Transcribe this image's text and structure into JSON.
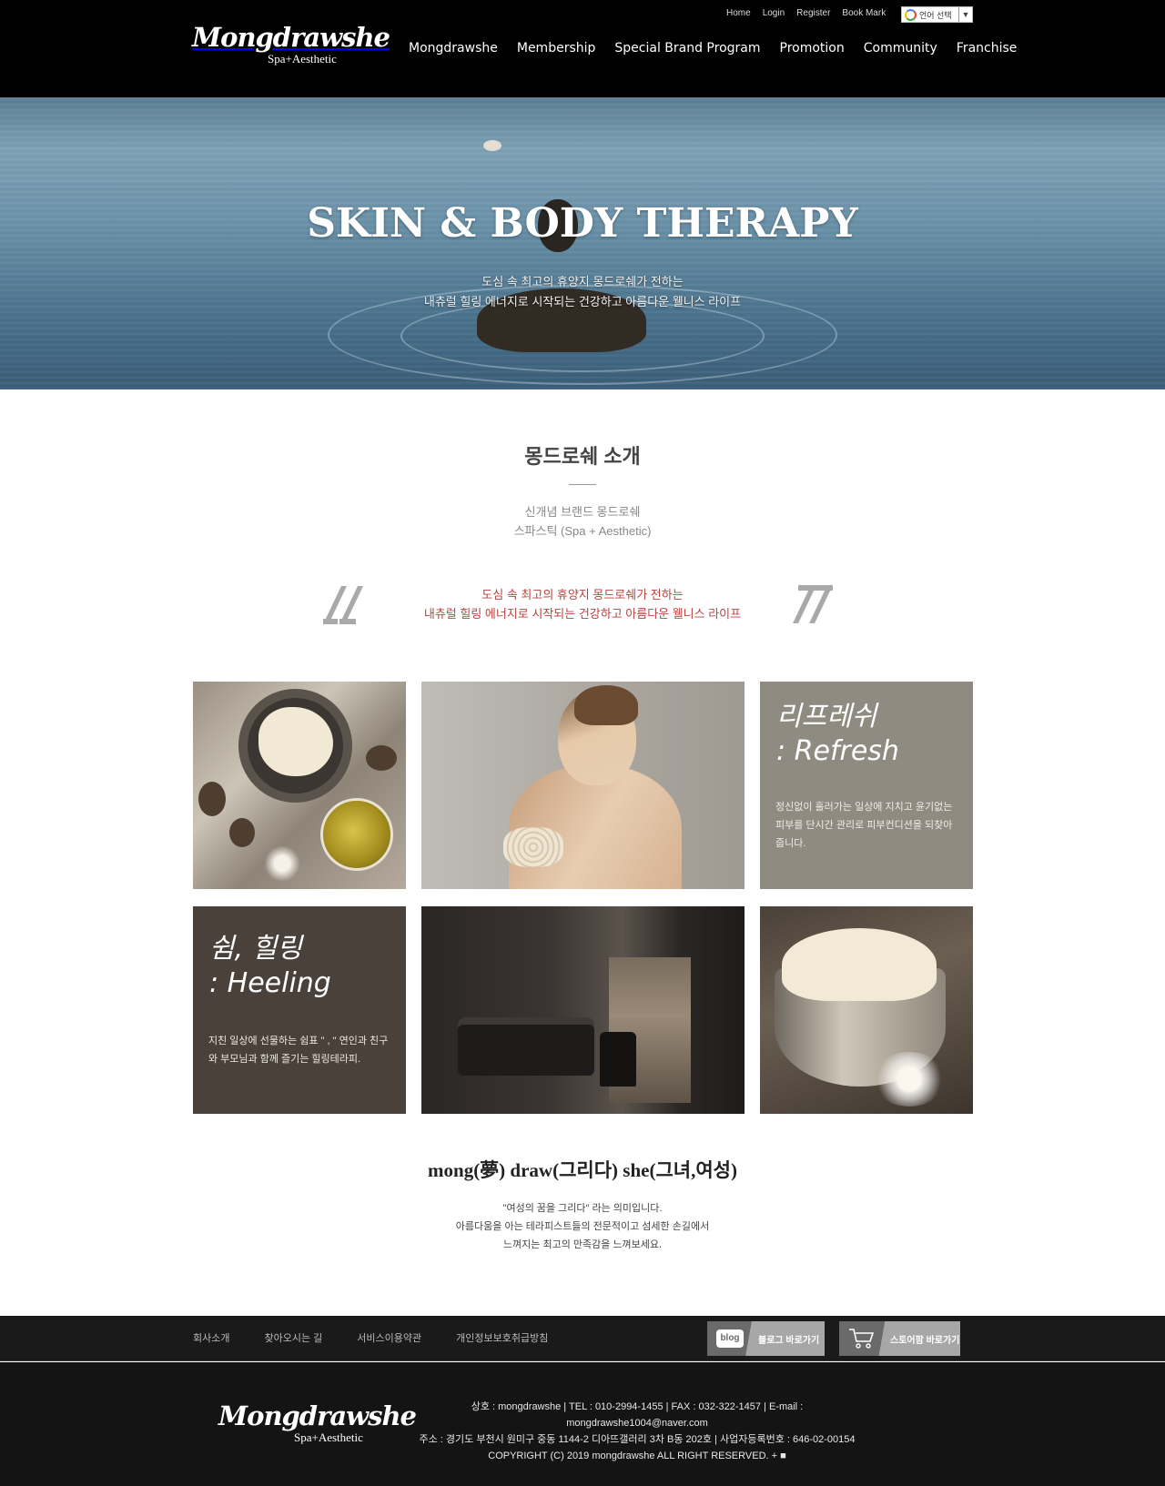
{
  "header": {
    "logo_script": "Mongdrawshe",
    "logo_sub": "Spa+Aesthetic",
    "util_links": [
      "Home",
      "Login",
      "Register",
      "Book Mark"
    ],
    "language_select": "언어 선택",
    "nav": [
      "Mongdrawshe",
      "Membership",
      "Special Brand Program",
      "Promotion",
      "Community",
      "Franchise"
    ]
  },
  "hero": {
    "title": "SKIN & BODY THERAPY",
    "line1": "도심 속 최고의 휴양지 몽드로쉐가 전하는",
    "line2": "내츄럴 힐링 에너지로 시작되는 건강하고 아름다운 웰니스 라이프"
  },
  "intro": {
    "title": "몽드로쉐 소개",
    "sub1": "신개념 브랜드 몽드로쉐",
    "sub2": "스파스틱 (Spa + Aesthetic)",
    "quote1": "도심 속 최고의 휴양지 몽드로쉐가 전하는",
    "quote2": "내츄럴 힐링 에너지로 시작되는 건강하고 아름다운 웰니스 라이프"
  },
  "gallery": {
    "refresh": {
      "title1": "리프레쉬",
      "title2": ": Refresh",
      "desc": "정신없이 흘러가는 일상에 지치고 윤기없는 피부를 단시간 관리로 피부컨디션을 되찾아줍니다."
    },
    "healing": {
      "title1": "쉼, 힐링",
      "title2": ": Heeling",
      "desc": "지친 일상에 선물하는 쉼표 \" , \" 연인과 친구와 부모님과 함께 즐기는 힐링테라피."
    }
  },
  "meaning": {
    "title": "mong(夢) draw(그리다) she(그녀,여성)",
    "line1": "\"여성의 꿈을 그리다\" 라는 의미입니다.",
    "line2": "아름다움을 아는 테라피스트들의 전문적이고 섬세한 손길에서",
    "line3": "느껴지는 최고의 만족감을 느껴보세요."
  },
  "footer_nav": {
    "links": [
      "회사소개",
      "찾아오시는 길",
      "서비스이용약관",
      "개인정보보호취급방침"
    ],
    "blog_icon_text": "blog",
    "blog_label": "블로그 바로가기",
    "store_label": "스토어팜 바로가기"
  },
  "footer": {
    "logo_script": "Mongdrawshe",
    "logo_sub": "Spa+Aesthetic",
    "line1": "상호 : mongdrawshe | TEL : 010-2994-1455 | FAX : 032-322-1457 | E-mail : mongdrawshe1004@naver.com",
    "line2": "주소 : 경기도 부천시 원미구 중동 1144-2 디아뜨갤러리 3차 B동 202호 | 사업자등록번호 : 646-02-00154",
    "line3": "COPYRIGHT (C) 2019 mongdrawshe ALL RIGHT RESERVED. + ■"
  },
  "icons": {
    "quote_open": "quote-open-icon",
    "quote_close": "quote-close-icon",
    "cart": "cart-icon",
    "google": "google-g-icon",
    "caret": "chevron-down-icon"
  },
  "colors": {
    "header_bg": "#000000",
    "accent_red": "#b8433f",
    "refresh_tile": "#8f8b80",
    "healing_tile": "#4b413b",
    "footer_bg": "#141414"
  }
}
